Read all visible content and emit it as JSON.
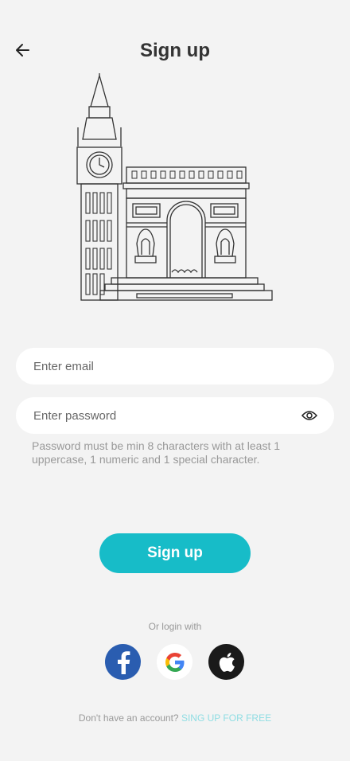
{
  "header": {
    "title": "Sign up",
    "back_icon": "arrow-left-icon"
  },
  "illustration": {
    "subject": "london-paris-landmarks"
  },
  "form": {
    "email_placeholder": "Enter email",
    "password_placeholder": "Enter password",
    "password_toggle_icon": "eye-icon",
    "password_hint": "Password must be min 8 characters with at least 1 uppercase, 1 numeric and 1 special character."
  },
  "actions": {
    "signup_label": "Sign up",
    "accent_color": "#17bcc8"
  },
  "social": {
    "label": "Or login with",
    "providers": [
      "facebook",
      "google",
      "apple"
    ],
    "facebook_color": "#2a5db0",
    "apple_color": "#1a1a1a"
  },
  "footer": {
    "prompt": "Don't have an account?",
    "link_label": "SING UP FOR FREE"
  }
}
